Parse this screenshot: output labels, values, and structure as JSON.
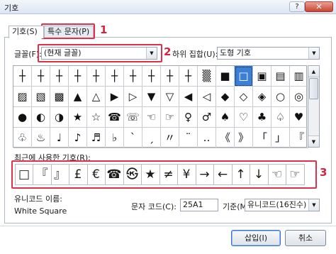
{
  "window": {
    "title": "기호",
    "help_label": "?",
    "close_label": "✕"
  },
  "tabs": [
    {
      "label": "기호(S)"
    },
    {
      "label": "특수 문자(P)"
    }
  ],
  "annotations": {
    "one": "1",
    "two": "2",
    "three": "3"
  },
  "font": {
    "label": "글꼴(F):",
    "value": "(현재 글꼴)"
  },
  "subset": {
    "label": "하위 집합(U):",
    "value": "도형 기호"
  },
  "symbol_grid": [
    [
      "┼",
      "┼",
      "┼",
      "┼",
      "┼",
      "┼",
      "┼",
      "┼",
      "┼",
      "┼",
      "▒",
      "■",
      "□",
      "▣",
      "▤",
      "▥"
    ],
    [
      "▨",
      "▧",
      "▩",
      "▲",
      "△",
      "▶",
      "▷",
      "▼",
      "▽",
      "◀",
      "◁",
      "◆",
      "◇",
      "◈",
      "○",
      "◎"
    ],
    [
      "●",
      "◐",
      "◑",
      "★",
      "☆",
      "☎",
      "☏",
      "☜",
      "☞",
      "♀",
      "♂",
      "♠",
      "♡",
      "♣",
      "♤",
      "♥"
    ],
    [
      "♧",
      "♨",
      "♩",
      "♪",
      "♬",
      "♭",
      "ˋ",
      "ˏ",
      "〃",
      "¨",
      "‥",
      "《",
      "》",
      "「",
      "」",
      "『"
    ]
  ],
  "recent": {
    "label": "최근에 사용한 기호(R):",
    "items": [
      "□",
      "『",
      "』",
      "£",
      "€",
      "☎",
      "㉿",
      "★",
      "≠",
      "¥",
      "→",
      "←",
      "↑",
      "↓",
      "☜",
      "☞"
    ]
  },
  "unicode_name": {
    "label": "유니코드 이름:",
    "value": "White Square"
  },
  "char_code": {
    "label": "문자 코드(C):",
    "value": "25A1"
  },
  "from": {
    "label": "기준(M):",
    "value": "유니코드(16진수)"
  },
  "buttons": {
    "insert": "삽입(I)",
    "cancel": "취소"
  }
}
